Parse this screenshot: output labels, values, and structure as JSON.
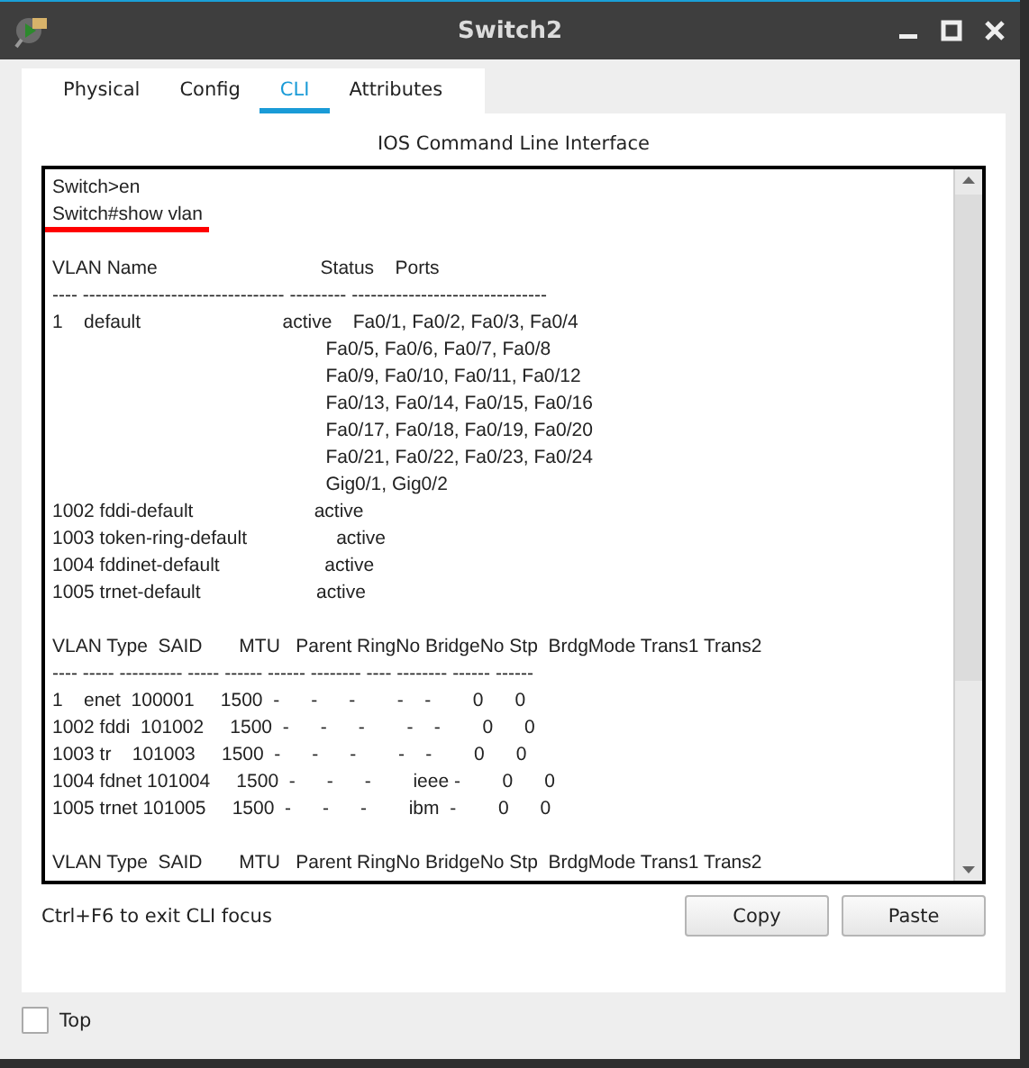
{
  "window": {
    "title": "Switch2"
  },
  "tabs": [
    {
      "label": "Physical",
      "selected": false
    },
    {
      "label": "Config",
      "selected": false
    },
    {
      "label": "CLI",
      "selected": true
    },
    {
      "label": "Attributes",
      "selected": false
    }
  ],
  "cli": {
    "heading": "IOS Command Line Interface",
    "lines": [
      {
        "kind": "text",
        "text": "Switch>en"
      },
      {
        "kind": "underlined",
        "text": "Switch#show vlan"
      },
      {
        "kind": "blank"
      },
      {
        "kind": "text",
        "text": "VLAN Name                               Status    Ports"
      },
      {
        "kind": "text",
        "text": "---- -------------------------------- --------- -------------------------------"
      },
      {
        "kind": "text",
        "text": "1    default                           active    Fa0/1, Fa0/2, Fa0/3, Fa0/4"
      },
      {
        "kind": "text",
        "text": "                                                    Fa0/5, Fa0/6, Fa0/7, Fa0/8"
      },
      {
        "kind": "text",
        "text": "                                                    Fa0/9, Fa0/10, Fa0/11, Fa0/12"
      },
      {
        "kind": "text",
        "text": "                                                    Fa0/13, Fa0/14, Fa0/15, Fa0/16"
      },
      {
        "kind": "text",
        "text": "                                                    Fa0/17, Fa0/18, Fa0/19, Fa0/20"
      },
      {
        "kind": "text",
        "text": "                                                    Fa0/21, Fa0/22, Fa0/23, Fa0/24"
      },
      {
        "kind": "text",
        "text": "                                                    Gig0/1, Gig0/2"
      },
      {
        "kind": "text",
        "text": "1002 fddi-default                       active"
      },
      {
        "kind": "text",
        "text": "1003 token-ring-default                 active"
      },
      {
        "kind": "text",
        "text": "1004 fddinet-default                    active"
      },
      {
        "kind": "text",
        "text": "1005 trnet-default                      active"
      },
      {
        "kind": "blank"
      },
      {
        "kind": "text",
        "text": "VLAN Type  SAID       MTU   Parent RingNo BridgeNo Stp  BrdgMode Trans1 Trans2"
      },
      {
        "kind": "text",
        "text": "---- ----- ---------- ----- ------ ------ -------- ---- -------- ------ ------"
      },
      {
        "kind": "text",
        "text": "1    enet  100001     1500  -      -      -        -    -        0      0"
      },
      {
        "kind": "text",
        "text": "1002 fddi  101002     1500  -      -      -        -    -        0      0"
      },
      {
        "kind": "text",
        "text": "1003 tr    101003     1500  -      -      -        -    -        0      0"
      },
      {
        "kind": "text",
        "text": "1004 fdnet 101004     1500  -      -      -        ieee -        0      0"
      },
      {
        "kind": "text",
        "text": "1005 trnet 101005     1500  -      -      -        ibm  -        0      0"
      },
      {
        "kind": "blank"
      },
      {
        "kind": "text",
        "text": "VLAN Type  SAID       MTU   Parent RingNo BridgeNo Stp  BrdgMode Trans1 Trans2"
      }
    ]
  },
  "hint": "Ctrl+F6 to exit CLI focus",
  "buttons": [
    "Copy",
    "Paste"
  ],
  "top_checkbox": {
    "label": "Top",
    "checked": false
  }
}
